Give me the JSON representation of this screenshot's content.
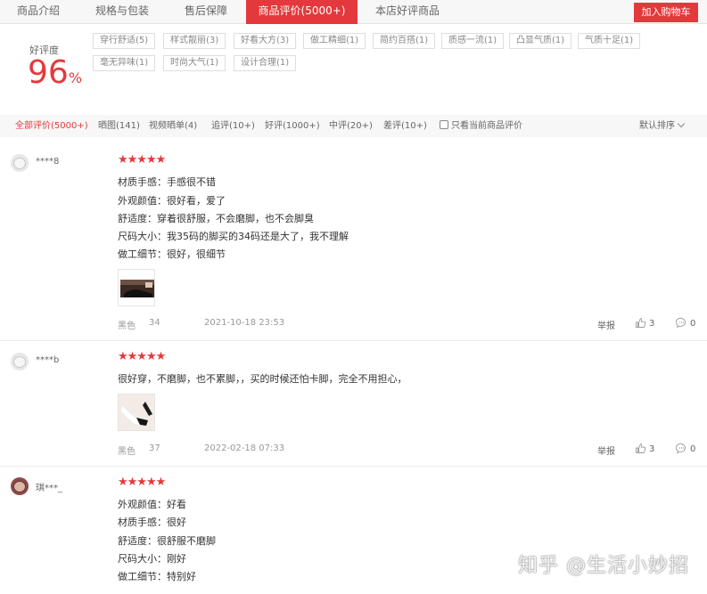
{
  "tabs": [
    {
      "label": "商品介绍",
      "active": false
    },
    {
      "label": "规格与包装",
      "active": false
    },
    {
      "label": "售后保障",
      "active": false
    },
    {
      "label": "商品评价(5000+)",
      "active": true
    },
    {
      "label": "本店好评商品",
      "active": false
    }
  ],
  "cart_button": "加入购物车",
  "rate": {
    "label": "好评度",
    "value": "96",
    "unit": "%"
  },
  "tags": [
    "穿行舒适(5)",
    "样式靓丽(3)",
    "好看大方(3)",
    "做工精细(1)",
    "简约百搭(1)",
    "质感一流(1)",
    "凸显气质(1)",
    "气质十足(1)",
    "毫无异味(1)",
    "时尚大气(1)",
    "设计合理(1)"
  ],
  "filters": [
    {
      "label": "全部评价(5000+)",
      "active": true
    },
    {
      "label": "晒图(141)",
      "active": false
    },
    {
      "label": "视频晒单(4)",
      "active": false
    },
    {
      "label": "追评(10+)",
      "active": false
    },
    {
      "label": "好评(1000+)",
      "active": false
    },
    {
      "label": "中评(20+)",
      "active": false
    },
    {
      "label": "差评(10+)",
      "active": false
    }
  ],
  "only_current_label": "只看当前商品评价",
  "sort_label": "默认排序",
  "comments": [
    {
      "user": "****8",
      "rating": 5,
      "lines": [
        "材质手感：手感很不错",
        "外观颜值：很好看，爱了",
        "舒适度：穿着很舒服，不会磨脚，也不会脚臭",
        "尺码大小：我35码的脚买的34码还是大了，我不理解",
        "做工细节：很好，很细节"
      ],
      "color": "黑色",
      "size": "34",
      "date": "2021-10-18 23:53",
      "report": "举报",
      "likes": "3",
      "replies": "0"
    },
    {
      "user": "****b",
      "rating": 5,
      "lines": [
        "很好穿，不磨脚，也不累脚，，买的时候还怕卡脚，完全不用担心，"
      ],
      "color": "黑色",
      "size": "37",
      "date": "2022-02-18 07:33",
      "report": "举报",
      "likes": "3",
      "replies": "0"
    },
    {
      "user": "琪***_",
      "rating": 5,
      "lines": [
        "外观颜值：好看",
        "材质手感：很好",
        "舒适度：很舒服不磨脚",
        "尺码大小：刚好",
        "做工细节：特别好"
      ]
    }
  ],
  "watermark": "知乎 @生活小妙招",
  "colors": {
    "accent": "#e4393c",
    "bar_bg": "#f7f7f7"
  }
}
